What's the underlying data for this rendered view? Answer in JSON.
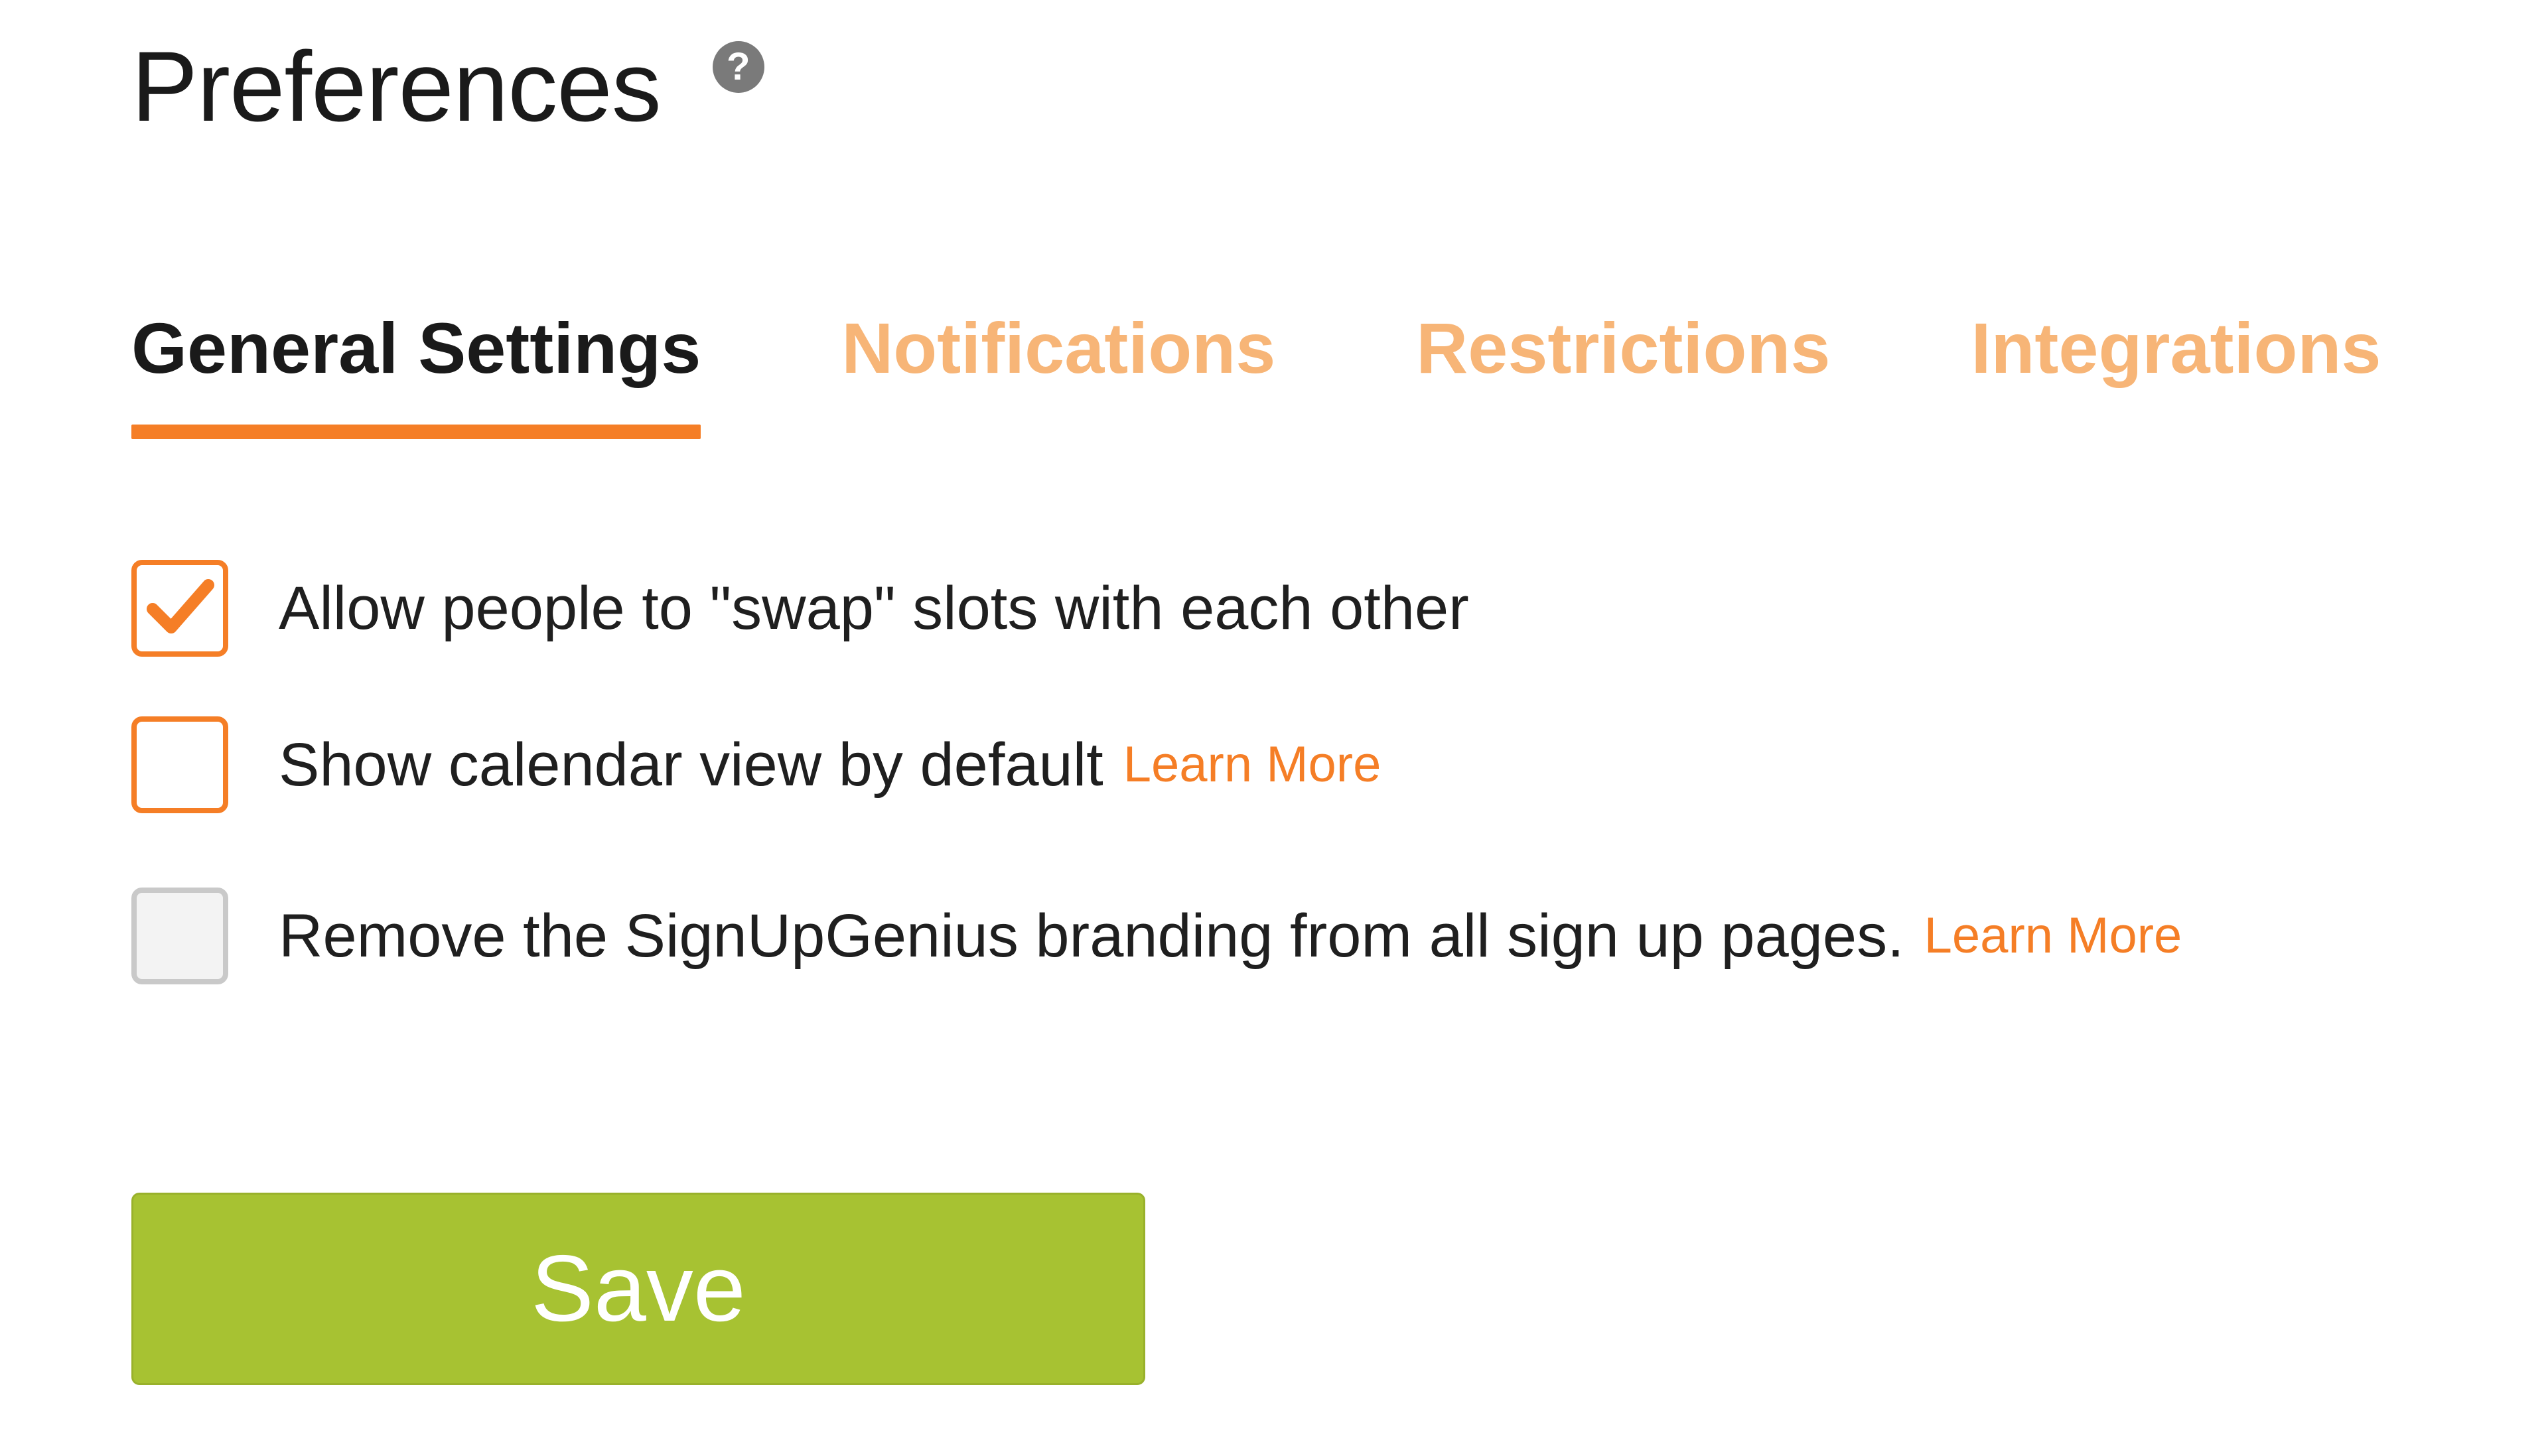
{
  "header": {
    "title": "Preferences",
    "help_icon_glyph": "?",
    "help_icon_name": "question-circle-icon"
  },
  "tabs": [
    {
      "label": "General Settings",
      "active": true
    },
    {
      "label": "Notifications",
      "active": false
    },
    {
      "label": "Restrictions",
      "active": false
    },
    {
      "label": "Integrations",
      "active": false
    }
  ],
  "options": [
    {
      "label": "Allow people to \"swap\" slots with each other",
      "checked": true,
      "enabled": true,
      "learn_more": ""
    },
    {
      "label": "Show calendar view by default",
      "checked": false,
      "enabled": true,
      "learn_more": "Learn More"
    },
    {
      "label": "Remove the SignUpGenius branding from all sign up pages.",
      "checked": false,
      "enabled": false,
      "learn_more": "Learn More"
    }
  ],
  "save_button": {
    "label": "Save"
  },
  "colors": {
    "accent_orange": "#f57e26",
    "inactive_tab": "#f7b577",
    "save_green": "#a7c232",
    "text": "#1a1a1a"
  }
}
